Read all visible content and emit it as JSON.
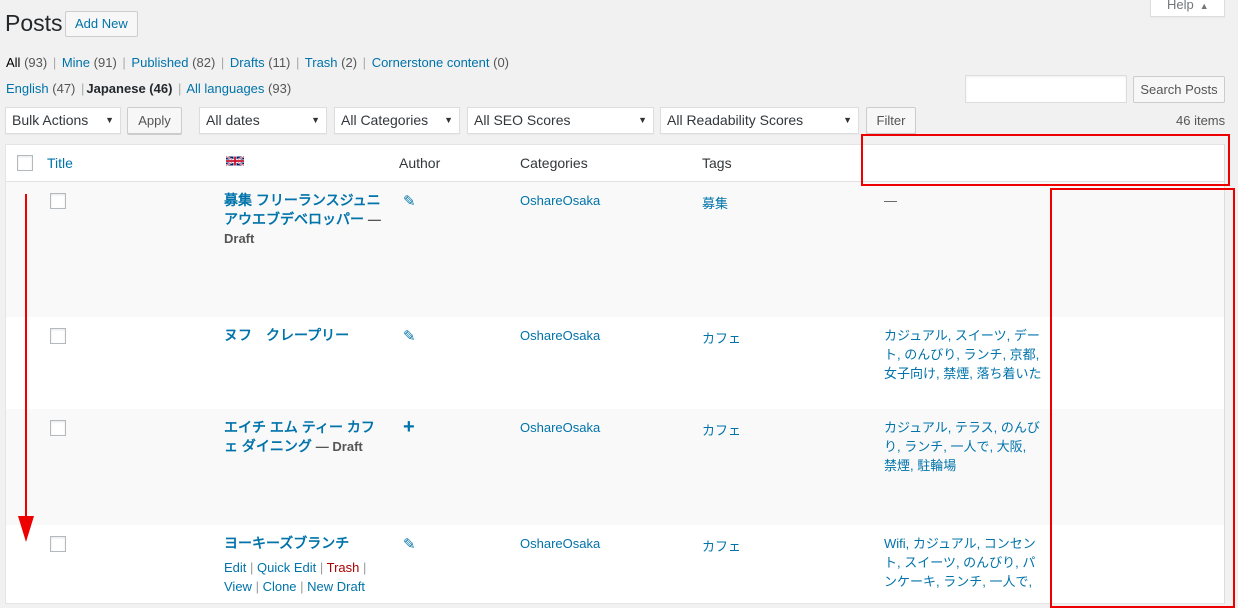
{
  "header": {
    "title": "Posts",
    "add_new": "Add New",
    "help": "Help"
  },
  "status_links": [
    {
      "label": "All",
      "count": "(93)"
    },
    {
      "label": "Mine",
      "count": "(91)"
    },
    {
      "label": "Published",
      "count": "(82)"
    },
    {
      "label": "Drafts",
      "count": "(11)"
    },
    {
      "label": "Trash",
      "count": "(2)"
    },
    {
      "label": "Cornerstone content",
      "count": "(0)"
    }
  ],
  "language_links": [
    {
      "label": "English",
      "count": "(47)"
    },
    {
      "label": "Japanese",
      "count": "(46)"
    },
    {
      "label": "All languages",
      "count": "(93)"
    }
  ],
  "search": {
    "value": "",
    "button": "Search Posts"
  },
  "filters": {
    "bulk_actions": "Bulk Actions",
    "apply": "Apply",
    "dates": "All dates",
    "categories": "All Categories",
    "seo": "All SEO Scores",
    "readability": "All Readability Scores",
    "filter": "Filter",
    "items_count": "46 items"
  },
  "columns": {
    "title": "Title",
    "author": "Author",
    "categories": "Categories",
    "tags": "Tags"
  },
  "rows": [
    {
      "title": "募集 フリーランスジュニアウエブデベロッパー",
      "state": "— Draft",
      "category": "OshareOsaka",
      "tag_category": "募集",
      "tags": "—"
    },
    {
      "title": "ヌフ　クレープリー",
      "state": "",
      "category": "OshareOsaka",
      "tag_category": "カフェ",
      "tags": "カジュアル, スイーツ, デート, のんびり, ランチ, 京都, 女子向け, 禁煙, 落ち着いた"
    },
    {
      "title": "エイチ エム ティー カフェ ダイニング",
      "state": "— Draft",
      "category": "OshareOsaka",
      "tag_category": "カフェ",
      "tags": "カジュアル, テラス, のんびり, ランチ, 一人で, 大阪, 禁煙, 駐輪場"
    },
    {
      "title": "ヨーキーズブランチ",
      "state": "",
      "category": "OshareOsaka",
      "tag_category": "カフェ",
      "tags": "Wifi, カジュアル, コンセント, スイーツ, のんびり, パンケーキ, ランチ, 一人で,",
      "actions": {
        "edit": "Edit",
        "quick_edit": "Quick Edit",
        "trash": "Trash",
        "view": "View",
        "clone": "Clone",
        "new_draft": "New Draft"
      }
    }
  ],
  "colors": {
    "annotation": "#e00000",
    "link": "#0073aa"
  },
  "icons": {
    "author_edit": "pencil-icon",
    "author_add": "plus-icon",
    "language": "uk-flag-icon"
  }
}
